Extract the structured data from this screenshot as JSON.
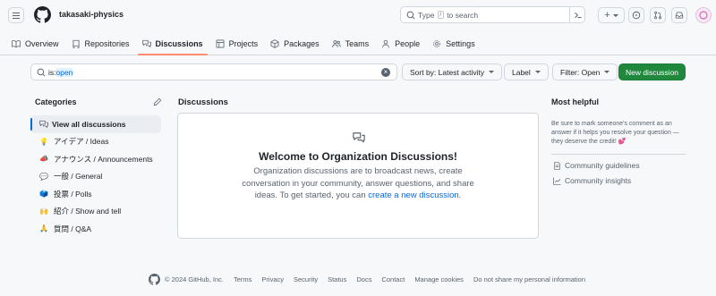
{
  "header": {
    "org_name": "takasaki-physics",
    "search_pre": "Type",
    "search_key": "/",
    "search_post": "to search",
    "create_label": "+",
    "avatar": "avatar"
  },
  "nav": [
    {
      "label": "Overview",
      "icon": "book-icon"
    },
    {
      "label": "Repositories",
      "icon": "repo-icon"
    },
    {
      "label": "Discussions",
      "icon": "comment-discussion-icon",
      "active": true
    },
    {
      "label": "Projects",
      "icon": "table-icon"
    },
    {
      "label": "Packages",
      "icon": "package-icon"
    },
    {
      "label": "Teams",
      "icon": "people-icon"
    },
    {
      "label": "People",
      "icon": "person-icon"
    },
    {
      "label": "Settings",
      "icon": "gear-icon"
    }
  ],
  "filter": {
    "query_prefix": "is:",
    "query_value": "open",
    "sort_label": "Sort by: Latest activity",
    "label_label": "Label",
    "filter_label": "Filter: Open",
    "new_label": "New discussion"
  },
  "categories": {
    "title": "Categories",
    "items": [
      {
        "emoji": "",
        "label": "View all discussions",
        "active": true
      },
      {
        "emoji": "💡",
        "label": "アイデア / Ideas"
      },
      {
        "emoji": "📣",
        "label": "アナウンス / Announcements"
      },
      {
        "emoji": "💬",
        "label": "一般 / General"
      },
      {
        "emoji": "🗳️",
        "label": "投票 / Polls"
      },
      {
        "emoji": "🙌",
        "label": "紹介 / Show and tell"
      },
      {
        "emoji": "🙏",
        "label": "質問 / Q&A"
      }
    ]
  },
  "discussions": {
    "title": "Discussions",
    "welcome": "Welcome to Organization Discussions!",
    "desc_before": "Organization discussions are to broadcast news, create conversation in your community, answer questions, and share ideas. To get started, you can ",
    "link": "create a new discussion",
    "desc_after": "."
  },
  "most_helpful": {
    "title": "Most helpful",
    "desc": "Be sure to mark someone's comment as an answer if it helps you resolve your question — they deserve the credit! 💕",
    "links": [
      "Community guidelines",
      "Community insights"
    ]
  },
  "footer": {
    "copyright": "© 2024 GitHub, Inc.",
    "links": [
      "Terms",
      "Privacy",
      "Security",
      "Status",
      "Docs",
      "Contact",
      "Manage cookies",
      "Do not share my personal information"
    ]
  }
}
